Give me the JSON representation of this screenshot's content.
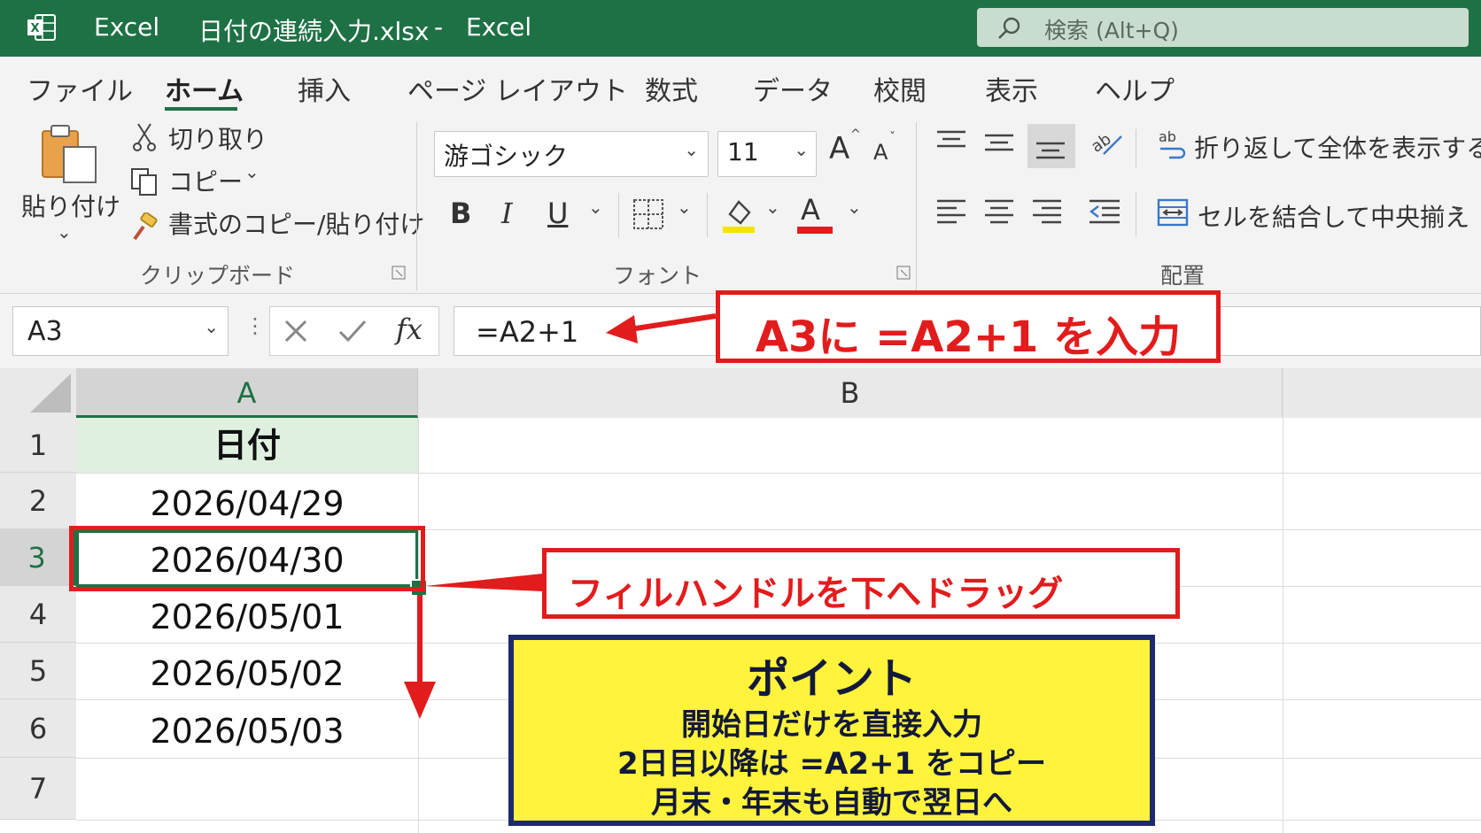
{
  "window": {
    "app_name": "Excel",
    "file_name": "日付の連続入力.xlsx",
    "separator": "-",
    "app_name_right": "Excel"
  },
  "search": {
    "placeholder": "検索 (Alt+Q)",
    "icon": "search-icon"
  },
  "ribbon_tabs": [
    "ファイル",
    "ホーム",
    "挿入",
    "ページ レイアウト",
    "数式",
    "データ",
    "校閲",
    "表示",
    "ヘルプ"
  ],
  "active_tab": "ホーム",
  "clipboard": {
    "paste_label": "貼り付け",
    "cut_label": "切り取り",
    "copy_label": "コピー",
    "format_painter_label": "書式のコピー/貼り付け",
    "group_label": "クリップボード"
  },
  "font": {
    "font_name": "游ゴシック",
    "font_size": "11",
    "bold": "B",
    "italic": "I",
    "underline": "U",
    "font_color_letter": "A",
    "grow_letter": "A",
    "shrink_letter": "A",
    "group_label": "フォント",
    "fill_color": "#f5e400",
    "font_color": "#e21c1c"
  },
  "alignment": {
    "wrap_text_label": "折り返して全体を表示する",
    "merge_label": "セルを結合して中央揃え",
    "group_label": "配置"
  },
  "formula_bar": {
    "name_box": "A3",
    "fx": "fx",
    "formula": "=A2+1"
  },
  "sheet": {
    "columns": [
      "A",
      "B"
    ],
    "rows": [
      "1",
      "2",
      "3",
      "4",
      "5",
      "6",
      "7"
    ],
    "selected_row": "3",
    "selected_column": "A",
    "cells_a": [
      "日付",
      "2026/04/29",
      "2026/04/30",
      "2026/05/01",
      "2026/05/02",
      "2026/05/03",
      ""
    ]
  },
  "annotations": {
    "formula_callout": "A3に =A2+1 を入力",
    "fill_callout": "フィルハンドルを下へドラッグ",
    "point_title": "ポイント",
    "point_lines": [
      "開始日だけを直接入力",
      "2日目以降は =A2+1 をコピー",
      "月末・年末も自動で翌日へ"
    ],
    "accent_red": "#e21c1c",
    "point_bg": "#fff33b",
    "point_border": "#1e2a6e"
  },
  "colors": {
    "brand_green": "#1e7145"
  }
}
